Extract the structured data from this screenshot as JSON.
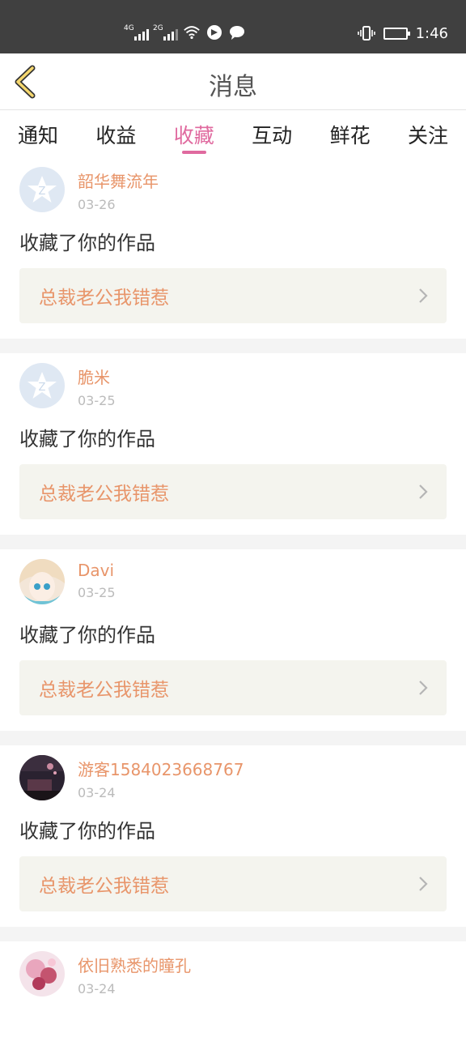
{
  "status_bar": {
    "sig1_label": "4G",
    "sig2_label": "2G",
    "time": "1:46"
  },
  "header": {
    "title": "消息"
  },
  "tabs": [
    {
      "label": "通知"
    },
    {
      "label": "收益"
    },
    {
      "label": "收藏"
    },
    {
      "label": "互动"
    },
    {
      "label": "鲜花"
    },
    {
      "label": "关注"
    }
  ],
  "active_tab": "收藏",
  "colors": {
    "accent": "#e06a9f",
    "name": "#e8956a",
    "card_bg": "#f4f4ee",
    "status_bar": "#404040"
  },
  "items": [
    {
      "name": "韶华舞流年",
      "date": "03-26",
      "action": "收藏了你的作品",
      "work": "总裁老公我错惹",
      "avatar": "default"
    },
    {
      "name": "脆米",
      "date": "03-25",
      "action": "收藏了你的作品",
      "work": "总裁老公我错惹",
      "avatar": "default"
    },
    {
      "name": "Davi",
      "date": "03-25",
      "action": "收藏了你的作品",
      "work": "总裁老公我错惹",
      "avatar": "anime"
    },
    {
      "name": "游客1584023668767",
      "date": "03-24",
      "action": "收藏了你的作品",
      "work": "总裁老公我错惹",
      "avatar": "night"
    },
    {
      "name": "依旧熟悉的瞳孔",
      "date": "03-24",
      "action": "",
      "work": "",
      "avatar": "pink"
    }
  ]
}
